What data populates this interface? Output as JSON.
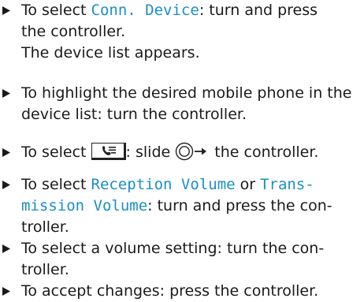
{
  "steps": [
    {
      "lines": [
        {
          "parts": [
            {
              "t": "To select "
            },
            {
              "t": "Conn. Device",
              "menu": true
            },
            {
              "t": ": turn and press"
            }
          ]
        },
        {
          "parts": [
            {
              "t": "the controller."
            }
          ]
        },
        {
          "parts": [
            {
              "t": "The device list appears."
            }
          ]
        }
      ]
    },
    {
      "lines": [
        {
          "parts": [
            {
              "t": "To highlight the desired mobile phone in the"
            }
          ]
        },
        {
          "parts": [
            {
              "t": "device list: turn the controller."
            }
          ]
        }
      ]
    },
    {
      "lines": [
        {
          "parts": [
            {
              "t": "To select "
            },
            {
              "icon": "phonebook-icon"
            },
            {
              "t": ": slide "
            },
            {
              "icon": "controller-slide-right-icon"
            },
            {
              "t": " the controller."
            }
          ]
        }
      ]
    },
    {
      "lines": [
        {
          "parts": [
            {
              "t": "To select "
            },
            {
              "t": "Reception Volume",
              "menu": true
            },
            {
              "t": " or "
            },
            {
              "t": "Trans-",
              "menu": true
            }
          ]
        },
        {
          "parts": [
            {
              "t": "mission Volume",
              "menu": true
            },
            {
              "t": ": turn and press the con-"
            }
          ]
        },
        {
          "parts": [
            {
              "t": "troller."
            }
          ]
        }
      ]
    },
    {
      "lines": [
        {
          "parts": [
            {
              "t": "To select a volume setting: turn the con-"
            }
          ]
        },
        {
          "parts": [
            {
              "t": "troller."
            }
          ]
        }
      ]
    },
    {
      "lines": [
        {
          "parts": [
            {
              "t": "To accept changes: press the controller."
            }
          ]
        }
      ]
    }
  ],
  "colors": {
    "menu_term": "#1b8fc3",
    "text": "#1a1a1a"
  }
}
